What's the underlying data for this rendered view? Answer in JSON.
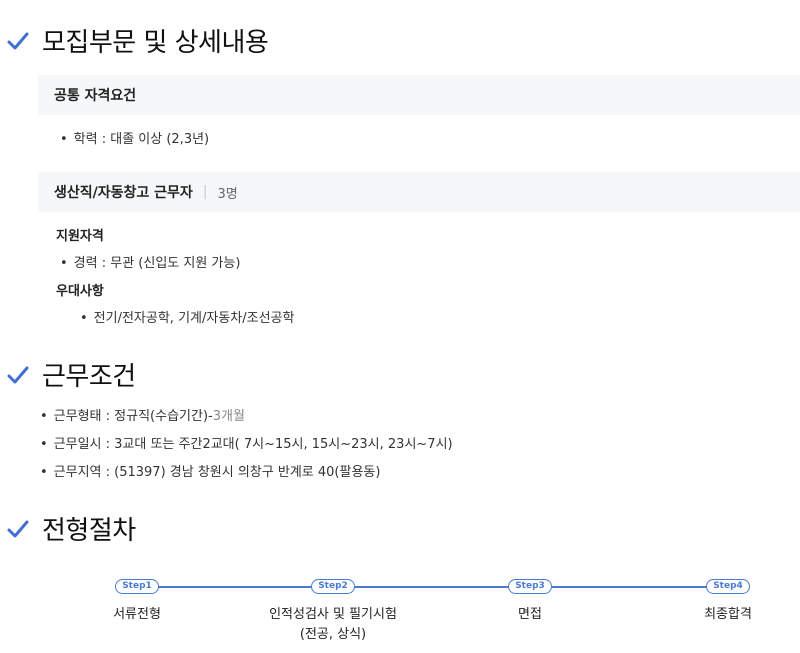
{
  "sections": {
    "recruit_title": "모집부문 및 상세내용",
    "conditions_title": "근무조건",
    "process_title": "전형절차"
  },
  "common": {
    "heading": "공통 자격요건",
    "education": "학력 : 대졸 이상 (2,3년)"
  },
  "position": {
    "name": "생산직/자동창고 근무자",
    "count": "3명",
    "qual_label": "지원자격",
    "experience": "경력 : 무관 (신입도 지원 가능)",
    "pref_label": "우대사항",
    "preference": "전기/전자공학, 기계/자동차/조선공학"
  },
  "conditions": {
    "type_main": "근무형태 : 정규직(수습기간)-",
    "type_extra": "3개월",
    "hours": "근무일시 : 3교대 또는 주간2교대( 7시~15시, 15시~23시, 23시~7시)",
    "location": "근무지역 : (51397) 경남 창원시 의창구 반계로 40(팔용동)"
  },
  "steps": [
    {
      "badge": "Step1",
      "label": "서류전형"
    },
    {
      "badge": "Step2",
      "label": "인적성검사 및 필기시험(전공, 상식)"
    },
    {
      "badge": "Step3",
      "label": "면접"
    },
    {
      "badge": "Step4",
      "label": "최종합격"
    }
  ],
  "colors": {
    "accent": "#4a7bd1",
    "check": "#3f6fd0"
  }
}
